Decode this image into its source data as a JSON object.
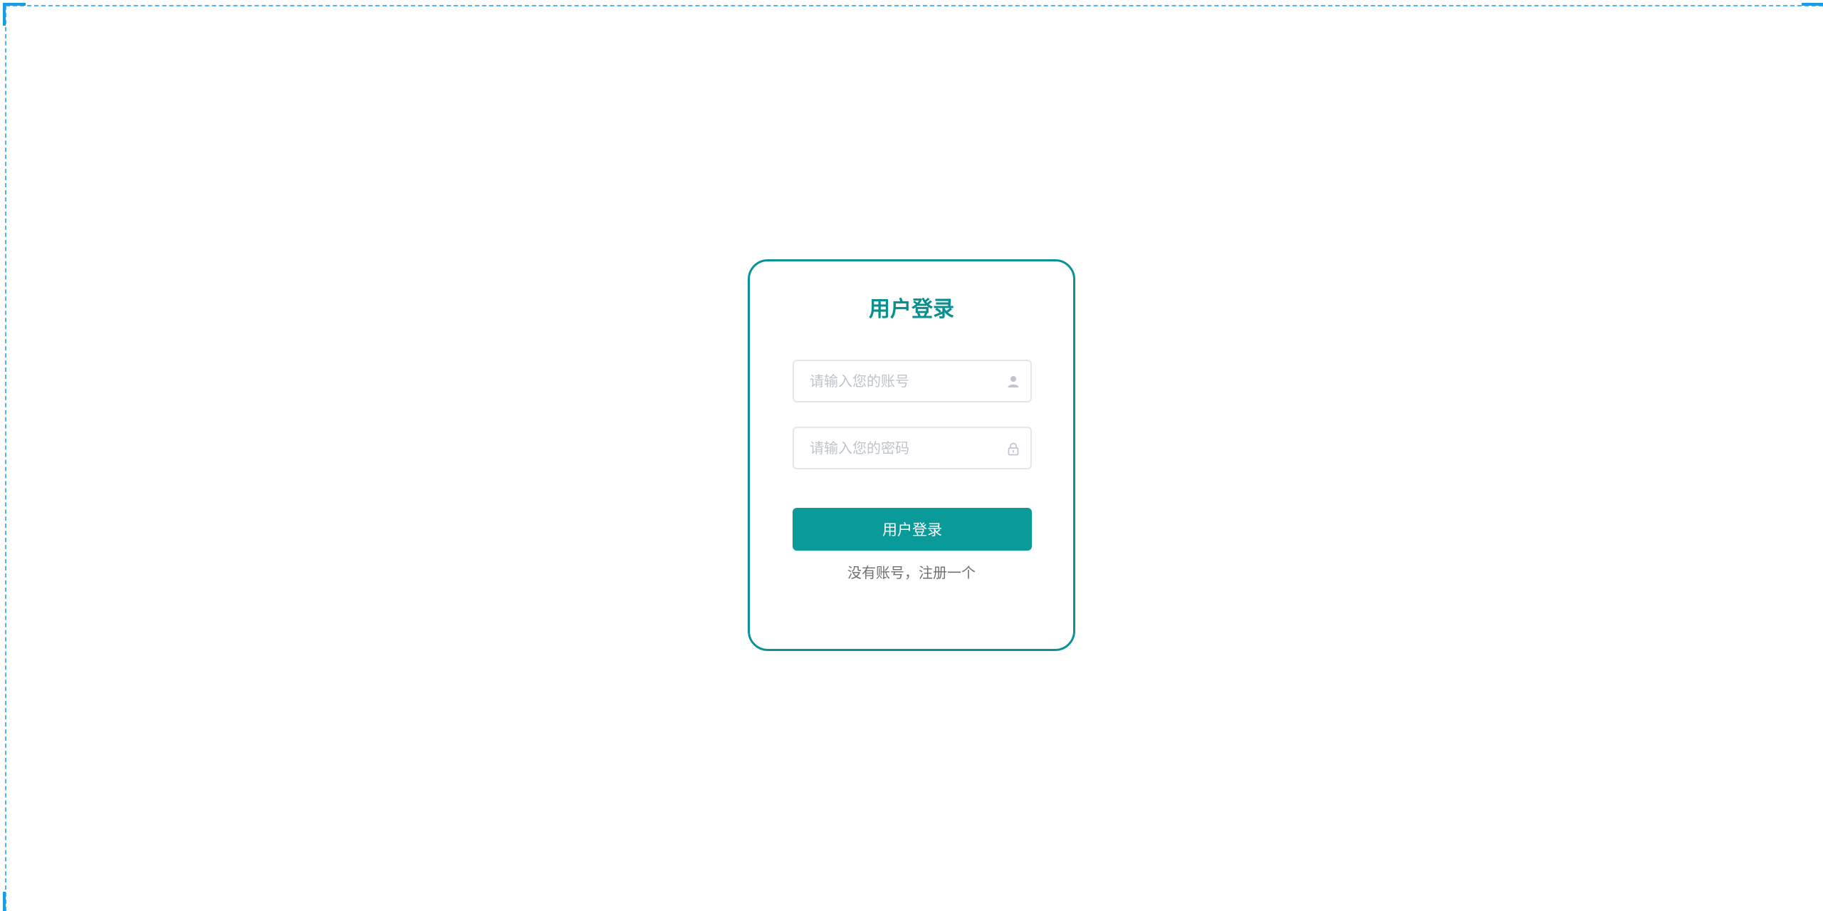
{
  "login_form": {
    "title": "用户登录",
    "account_input": {
      "placeholder": "请输入您的账号",
      "value": "",
      "icon": "user-icon"
    },
    "password_input": {
      "placeholder": "请输入您的密码",
      "value": "",
      "icon": "lock-icon"
    },
    "submit_label": "用户登录",
    "register_link": "没有账号，注册一个"
  },
  "colors": {
    "accent": "#0a9396",
    "button": "#0a9a9a",
    "frame_guide": "#1a9be8",
    "placeholder": "#bfc3cb"
  }
}
